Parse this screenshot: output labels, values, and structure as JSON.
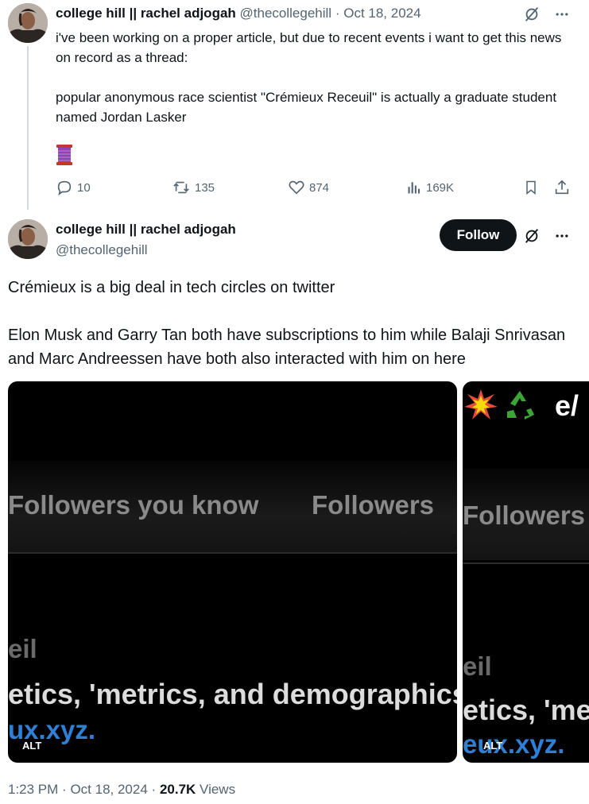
{
  "tweet1": {
    "author_name": "college hill || rachel adjogah",
    "handle": "@thecollegehill",
    "separator": "·",
    "date": "Oct 18, 2024",
    "text_line1": "i've been working on a proper article, but due to recent events i want to get this news on record as a thread:",
    "text_line2": "popular anonymous race scientist \"Crémieux Receuil\" is actually a graduate student named Jordan Lasker",
    "emoji": "spool-of-thread-emoji",
    "replies": "10",
    "reposts": "135",
    "likes": "874",
    "views": "169K"
  },
  "tweet2": {
    "author_name": "college hill || rachel adjogah",
    "handle": "@thecollegehill",
    "follow_label": "Follow",
    "paragraph1": "Crémieux is a big deal in tech circles on twitter",
    "paragraph2": "Elon Musk and Garry Tan both have subscriptions to him while Balaji Snrivasan and Marc Andreessen have both also interacted with him on here",
    "image1": {
      "tab1": "Followers you know",
      "tab2": "Followers",
      "line_a": "eil",
      "line_b": "etics, 'metrics, and demographics. R",
      "line_c": "ux.xyz.",
      "alt": "ALT"
    },
    "image2": {
      "top": "e/",
      "tab1": "Followers",
      "line_a": "eil",
      "line_b": "etics, 'me",
      "line_c": "eux.xyz.",
      "alt": "ALT"
    },
    "time": "1:23 PM",
    "date": "Oct 18, 2024",
    "views_count": "20.7K",
    "views_label": "Views",
    "separator": "·"
  },
  "colors": {
    "text": "#0f1419",
    "muted": "#536471",
    "thread_line": "#cfd9de",
    "follow_bg": "#0f1419",
    "link": "#2f7fd6"
  },
  "icons": [
    "grok-icon",
    "more-icon",
    "reply-icon",
    "repost-icon",
    "like-icon",
    "views-icon",
    "bookmark-icon",
    "share-icon"
  ]
}
